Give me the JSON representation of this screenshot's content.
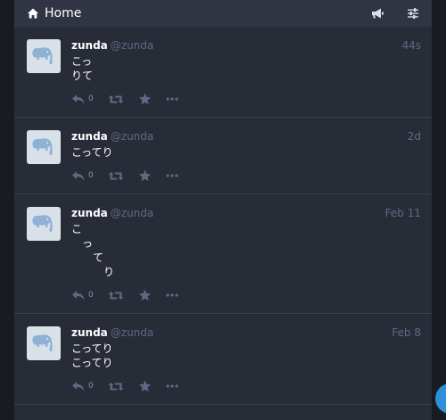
{
  "header": {
    "title": "Home"
  },
  "statuses": [
    {
      "display_name": "zunda",
      "acct": "@zunda",
      "time": "44s",
      "content": "こっ\nりて",
      "reply_count": "0",
      "actions_extra": "•••"
    },
    {
      "display_name": "zunda",
      "acct": "@zunda",
      "time": "2d",
      "content": "こってり",
      "reply_count": "0",
      "actions_extra": "•••"
    },
    {
      "display_name": "zunda",
      "acct": "@zunda",
      "time": "Feb 11",
      "content": "こ\n　っ\n　　て\n　　　り",
      "reply_count": "0",
      "actions_extra": "•••"
    },
    {
      "display_name": "zunda",
      "acct": "@zunda",
      "time": "Feb 8",
      "content": "こってり\nこってり",
      "reply_count": "0",
      "actions_extra": "•••"
    }
  ],
  "colors": {
    "background": "#191b22",
    "column": "#282c37",
    "header": "#313543",
    "muted": "#606984",
    "accent": "#2b90d9"
  }
}
